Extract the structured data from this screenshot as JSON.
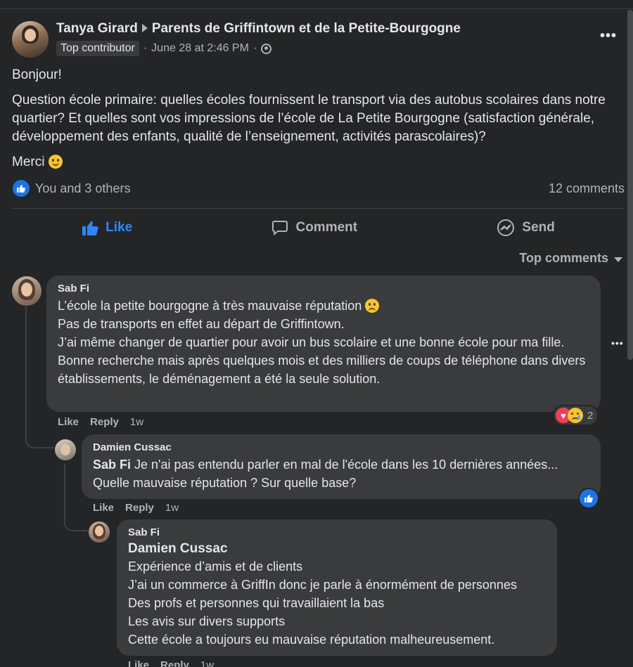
{
  "post": {
    "author": "Tanya Girard",
    "group": "Parents de Griffintown et de la Petite-Bourgogne",
    "badge": "Top contributor",
    "timestamp": "June 28 at 2:46 PM",
    "paragraph_1": "Bonjour!",
    "paragraph_2": "Question école primaire: quelles écoles fournissent le transport via des autobus scolaires dans notre quartier? Et quelles sont vos impressions de l’école de La Petite Bourgogne (satisfaction générale, développement des enfants, qualité de l’enseignement, activités parascolaires)?",
    "paragraph_3": "Merci",
    "reactions_text": "You and 3 others",
    "comments_count": "12 comments",
    "more_icon": "more-horizontal-icon"
  },
  "actions": {
    "like": "Like",
    "comment": "Comment",
    "send": "Send"
  },
  "sort_label": "Top comments",
  "comments": [
    {
      "author": "Sab Fi",
      "lines": [
        "L’école la petite bourgogne à très mauvaise réputation",
        "Pas de transports en effet au départ de Griffintown.",
        "J’ai même changer de quartier pour avoir un bus scolaire et une bonne école pour ma fille.",
        "Bonne recherche mais après quelques mois et des milliers de coups de téléphone dans divers établissements, le déménagement a été la seule solution."
      ],
      "like": "Like",
      "reply": "Reply",
      "time": "1w",
      "reaction_count": "2"
    },
    {
      "author": "Damien Cussac",
      "mention": "Sab Fi",
      "lines": [
        "Je n'ai pas entendu parler en mal de l'école dans les 10 dernières années...",
        "Quelle mauvaise réputation ? Sur quelle base?"
      ],
      "like": "Like",
      "reply": "Reply",
      "time": "1w"
    },
    {
      "author": "Sab Fi",
      "mention": "Damien Cussac",
      "lines": [
        "Expérience d’amis et de clients",
        "J’ai un commerce à GriffIn donc je parle à énormément de personnes",
        "Des profs et personnes qui travaillaient la bas",
        "Les avis sur divers supports",
        "Cette école a toujours eu mauvaise réputation malheureusement."
      ],
      "like": "Like",
      "reply": "Reply",
      "time": "1w"
    }
  ],
  "colors": {
    "background": "#242526",
    "bubble": "#3a3b3c",
    "accent": "#2d88ff",
    "text": "#e4e6eb",
    "muted": "#b0b3b8"
  }
}
